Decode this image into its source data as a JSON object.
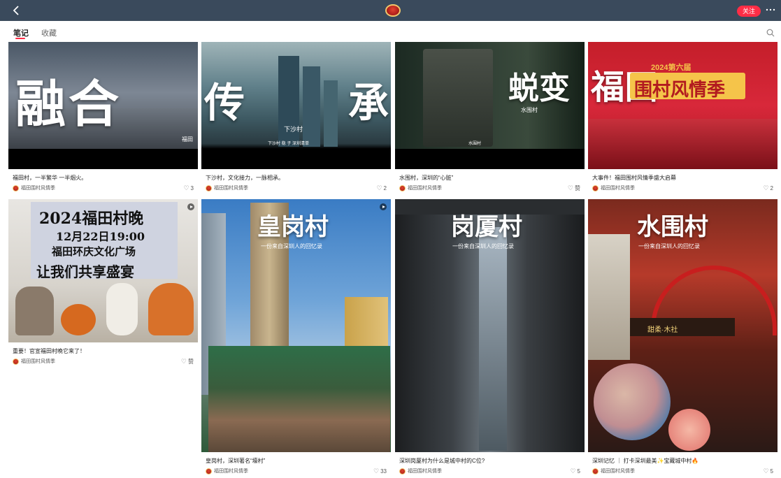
{
  "topbar": {
    "back_icon": "chevron-left-icon",
    "follow_label": "关注",
    "more_icon": "more-dots-icon"
  },
  "tabs": [
    {
      "label": "笔记",
      "active": true
    },
    {
      "label": "收藏",
      "active": false
    }
  ],
  "search_icon": "search-icon",
  "notes": [
    {
      "title": "福田村，一半繁华 一半烟火。",
      "author": "福田围村风情季",
      "likes": "3",
      "overlay_big": "融合",
      "overlay_small": "福田"
    },
    {
      "title": "下沙村，文化接力，一脉相承。",
      "author": "福田围村风情季",
      "likes": "2",
      "overlay_big_left": "传",
      "overlay_big_right": "承",
      "overlay_small": "下沙村",
      "overlay_caption": "下沙村 稳 子 深圳清单"
    },
    {
      "title": "水围村，深圳的“心脏”",
      "author": "福田围村风情季",
      "likes": "赞",
      "overlay_big": "蜕变",
      "overlay_small": "水围村",
      "overlay_caption": "水围村"
    },
    {
      "title": "大事件！福田围村风情季盛大启幕",
      "author": "福田围村风情季",
      "likes": "2",
      "overlay_big": "福田",
      "overlay_banner": "围村风情季",
      "overlay_year": "2024第六届"
    },
    {
      "title": "重要！官宣福田村晚它来了！",
      "author": "福田围村风情季",
      "likes": "赞",
      "poster_lines": [
        "2024福田村晚",
        "12月22日19:00",
        "福田环庆文化广场",
        "让我们共享盛宴"
      ]
    },
    {
      "title": "皇岗村，深圳著名“壕村”",
      "author": "福田围村风情季",
      "likes": "33",
      "overlay_big": "皇岗村",
      "overlay_sub": "一份来自深圳人的回忆录"
    },
    {
      "title": "深圳岗厦村为什么是城中村的C位?",
      "author": "福田围村风情季",
      "likes": "5",
      "overlay_big": "岗厦村",
      "overlay_sub": "一份来自深圳人的回忆录"
    },
    {
      "title": "深圳记忆 ｜ 打卡深圳最美✨宝藏城中村🔥",
      "author": "福田围村风情季",
      "likes": "5",
      "overlay_big": "水围村",
      "overlay_sub": "一份来自深圳人的回忆录",
      "sign_text": "甜柔·木社"
    }
  ],
  "colors": {
    "topbar": "#3a4a5c",
    "accent": "#ff2d46"
  }
}
